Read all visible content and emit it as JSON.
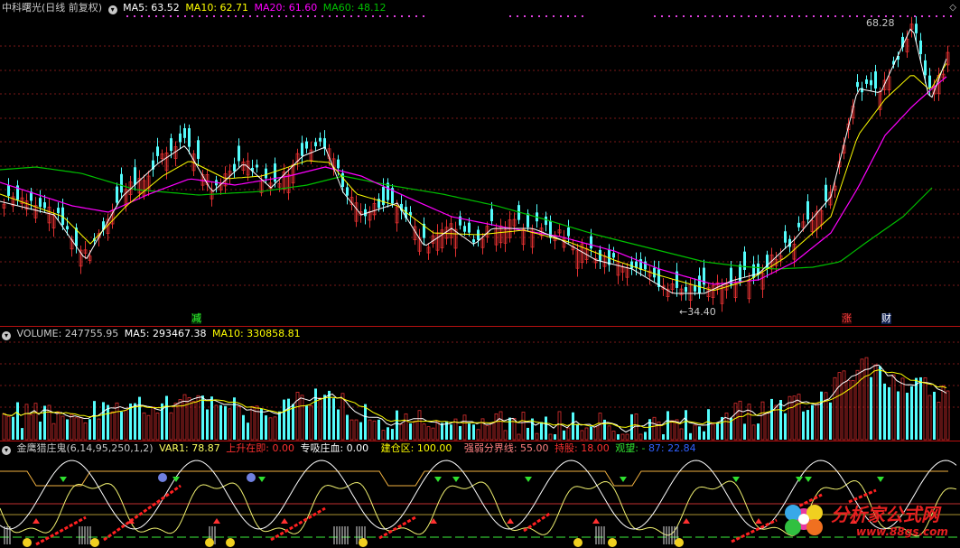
{
  "price_header": {
    "title": "中科曙光(日线 前复权)",
    "ma5": "MA5: 63.52",
    "ma10": "MA10: 62.71",
    "ma20": "MA20: 61.60",
    "ma60": "MA60: 48.12"
  },
  "price_annotations": {
    "high": "68.28",
    "low": "34.40",
    "tag_jian": "减",
    "tag_zhang": "涨",
    "tag_cai": "财"
  },
  "volume_header": {
    "volume": "VOLUME: 247755.95",
    "ma5": "MA5: 293467.38",
    "ma10": "MA10: 330858.81"
  },
  "indicator_header": {
    "name": "金鹰猎庄鬼(6,14,95,250,1,2)",
    "var1": "VAR1: 78.87",
    "rise": "上升在即: 0.00",
    "absorb": "专吸庄血: 0.00",
    "build": "建仓区: 100.00",
    "divide": "强弱分界线: 55.00",
    "hold": "持股: 18.00",
    "watch_label": "观望: -",
    "watch_value": "87: 22.84"
  },
  "watermark": {
    "text": "分析家公式网",
    "url": "www.88gs.com"
  },
  "colors": {
    "up": "#e03030",
    "down": "#54fcfc",
    "ma5": "#ffffff",
    "ma10": "#ffff00",
    "ma20": "#ff00ff",
    "ma60": "#00c000",
    "separator": "#b81010"
  }
}
